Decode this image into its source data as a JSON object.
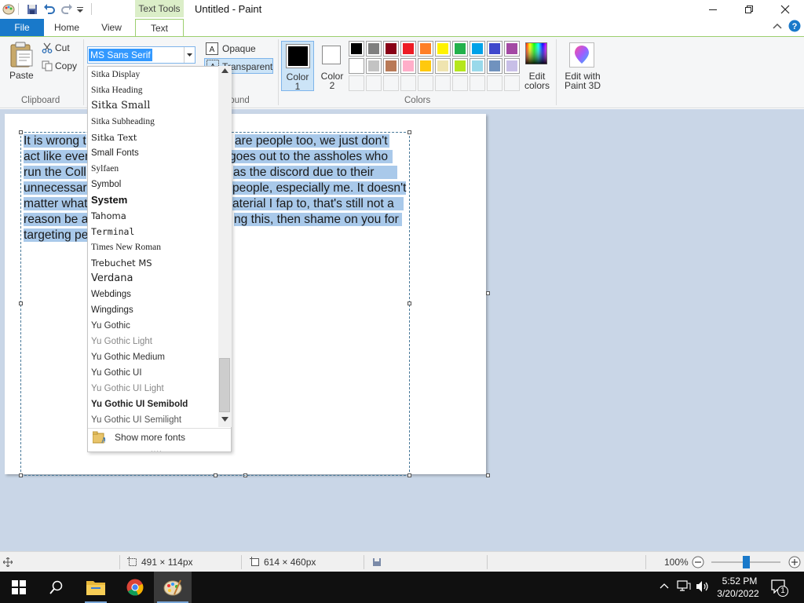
{
  "window": {
    "title": "Untitled - Paint",
    "context_tab": "Text Tools"
  },
  "tabs": {
    "file": "File",
    "home": "Home",
    "view": "View",
    "text": "Text"
  },
  "clipboard": {
    "paste": "Paste",
    "cut": "Cut",
    "copy": "Copy",
    "group": "Clipboard"
  },
  "font": {
    "selected": "MS Sans Serif"
  },
  "background": {
    "opaque": "Opaque",
    "transparent": "Transparent",
    "group_partial": "ground"
  },
  "colors": {
    "color1_label": "Color",
    "color1_num": "1",
    "color2_label": "Color",
    "color2_num": "2",
    "group": "Colors",
    "edit_colors_1": "Edit",
    "edit_colors_2": "colors",
    "paint3d_1": "Edit with",
    "paint3d_2": "Paint 3D",
    "color1_value": "#000000",
    "color2_value": "#ffffff",
    "palette_row1": [
      "#000000",
      "#7f7f7f",
      "#880015",
      "#ed1c24",
      "#ff7f27",
      "#fff200",
      "#22b14c",
      "#00a2e8",
      "#3f48cc",
      "#a349a4"
    ],
    "palette_row2": [
      "#ffffff",
      "#c3c3c3",
      "#b97a57",
      "#ffaec9",
      "#ffc90e",
      "#efe4b0",
      "#b5e61d",
      "#99d9ea",
      "#7092be",
      "#c8bfe7"
    ]
  },
  "font_list": [
    {
      "name": "Sitka Display",
      "ff": "Liberation Serif",
      "fw": "normal",
      "color": "#222"
    },
    {
      "name": "Sitka Heading",
      "ff": "Liberation Serif",
      "fw": "normal",
      "color": "#222"
    },
    {
      "name": "Sitka Small",
      "ff": "DejaVu Serif",
      "fw": "normal",
      "color": "#222"
    },
    {
      "name": "Sitka Subheading",
      "ff": "Liberation Serif",
      "fw": "normal",
      "color": "#222"
    },
    {
      "name": "Sitka Text",
      "ff": "DejaVu Serif",
      "fw": "normal",
      "color": "#222"
    },
    {
      "name": "Small Fonts",
      "ff": "Liberation Sans",
      "fw": "normal",
      "color": "#222"
    },
    {
      "name": "Sylfaen",
      "ff": "Liberation Serif",
      "fw": "normal",
      "color": "#222"
    },
    {
      "name": "Symbol",
      "ff": "Liberation Sans",
      "fw": "normal",
      "color": "#222"
    },
    {
      "name": "System",
      "ff": "Liberation Sans",
      "fw": "bold",
      "color": "#111"
    },
    {
      "name": "Tahoma",
      "ff": "DejaVu Sans",
      "fw": "normal",
      "color": "#222"
    },
    {
      "name": "Terminal",
      "ff": "DejaVu Sans Mono",
      "fw": "normal",
      "color": "#222"
    },
    {
      "name": "Times New Roman",
      "ff": "Liberation Serif",
      "fw": "normal",
      "color": "#222"
    },
    {
      "name": "Trebuchet MS",
      "ff": "DejaVu Sans",
      "fw": "normal",
      "color": "#222"
    },
    {
      "name": "Verdana",
      "ff": "DejaVu Sans",
      "fw": "normal",
      "color": "#222"
    },
    {
      "name": "Webdings",
      "ff": "Liberation Sans",
      "fw": "normal",
      "color": "#222"
    },
    {
      "name": "Wingdings",
      "ff": "Liberation Sans",
      "fw": "normal",
      "color": "#222"
    },
    {
      "name": "Yu Gothic",
      "ff": "Liberation Sans",
      "fw": "normal",
      "color": "#333"
    },
    {
      "name": "Yu Gothic Light",
      "ff": "Liberation Sans",
      "fw": "normal",
      "color": "#888"
    },
    {
      "name": "Yu Gothic Medium",
      "ff": "Liberation Sans",
      "fw": "normal",
      "color": "#333"
    },
    {
      "name": "Yu Gothic UI",
      "ff": "Liberation Sans",
      "fw": "normal",
      "color": "#333"
    },
    {
      "name": "Yu Gothic UI Light",
      "ff": "Liberation Sans",
      "fw": "normal",
      "color": "#888"
    },
    {
      "name": "Yu Gothic UI Semibold",
      "ff": "Liberation Sans",
      "fw": "bold",
      "color": "#222"
    },
    {
      "name": "Yu Gothic UI Semilight",
      "ff": "Liberation Sans",
      "fw": "normal",
      "color": "#555"
    }
  ],
  "show_more_fonts": "Show more fonts",
  "canvas_text": [
    "It is wrong t",
    "are people too, we just don't",
    "act like ever",
    "goes out to the assholes who",
    "run the Coll",
    "as the discord due to their",
    "unnecessar",
    "people, especially me. It doesn't",
    "matter what",
    "aterial I fap to, that's still not a",
    "reason be a",
    "ng this, then shame on you for",
    "targeting pe"
  ],
  "status": {
    "selection": "491 × 114px",
    "canvas_size": "614 × 460px",
    "zoom": "100%",
    "zoom_level_pct": 50
  },
  "taskbar": {
    "time": "5:52 PM",
    "date": "3/20/2022",
    "notifications": "1"
  }
}
